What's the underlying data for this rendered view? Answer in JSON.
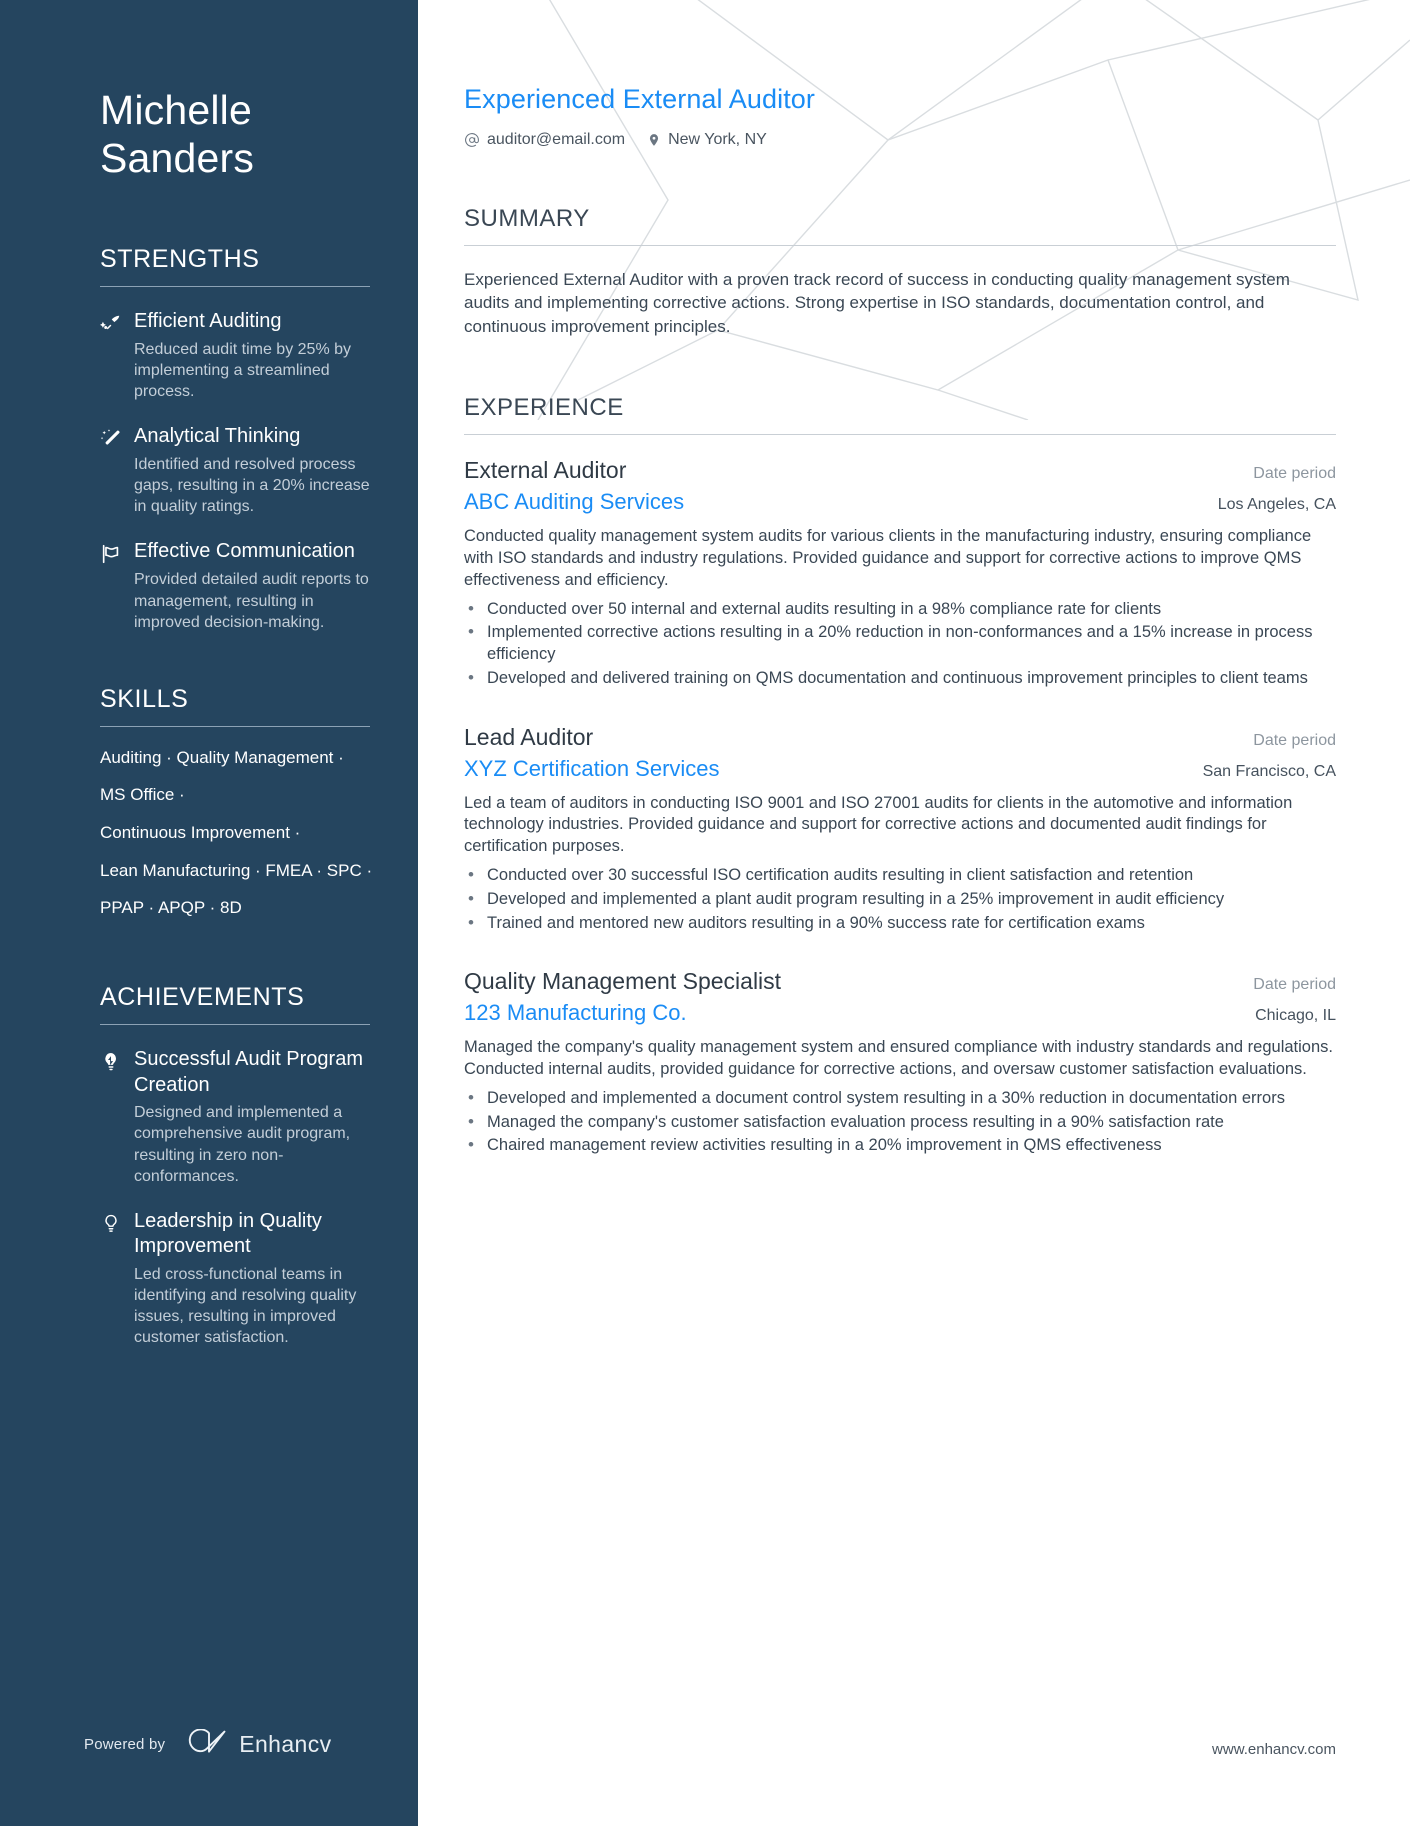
{
  "theme": {
    "sidebar_bg": "#25455f",
    "accent_blue": "#1a8cf5",
    "body_text": "#3a4754",
    "muted_text": "#8d969f"
  },
  "sidebar": {
    "name_first": "Michelle",
    "name_last": "Sanders",
    "strengths_heading": "STRENGTHS",
    "strengths": [
      {
        "icon": "rocket-trend-icon",
        "title": "Efficient Auditing",
        "desc": "Reduced audit time by 25% by implementing a streamlined process."
      },
      {
        "icon": "magic-wand-icon",
        "title": "Analytical Thinking",
        "desc": "Identified and resolved process gaps, resulting in a 20% increase in quality ratings."
      },
      {
        "icon": "flag-icon",
        "title": "Effective Communication",
        "desc": "Provided detailed audit reports to management, resulting in improved decision-making."
      }
    ],
    "skills_heading": "SKILLS",
    "skills_lines": [
      "Auditing · Quality Management ·",
      "MS Office ·",
      "Continuous Improvement ·",
      "Lean Manufacturing · FMEA · SPC ·",
      "PPAP · APQP · 8D"
    ],
    "achievements_heading": "ACHIEVEMENTS",
    "achievements": [
      {
        "icon": "lightbulb-filled-icon",
        "title": "Successful Audit Program Creation",
        "desc": "Designed and implemented a comprehensive audit program, resulting in zero non-conformances."
      },
      {
        "icon": "lightbulb-outline-icon",
        "title": "Leadership in Quality Improvement",
        "desc": "Led cross-functional teams in identifying and resolving quality issues, resulting in improved customer satisfaction."
      }
    ],
    "footer": {
      "powered_by": "Powered by",
      "brand": "Enhancv",
      "logo_icon": "enhancv-infinity-icon"
    }
  },
  "main": {
    "headline": "Experienced External Auditor",
    "contact": [
      {
        "icon": "at-sign-icon",
        "value": "auditor@email.com"
      },
      {
        "icon": "map-pin-icon",
        "value": "New York, NY"
      }
    ],
    "summary": {
      "heading": "SUMMARY",
      "text": "Experienced External Auditor with a proven track record of success in conducting quality management system audits and implementing corrective actions. Strong expertise in ISO standards, documentation control, and continuous improvement principles."
    },
    "experience": {
      "heading": "EXPERIENCE",
      "jobs": [
        {
          "position": "External Auditor",
          "date": "Date period",
          "company": "ABC Auditing Services",
          "location": "Los Angeles, CA",
          "description": "Conducted quality management system audits for various clients in the manufacturing industry, ensuring compliance with ISO standards and industry regulations. Provided guidance and support for corrective actions to improve QMS effectiveness and efficiency.",
          "bullets": [
            "Conducted over 50 internal and external audits resulting in a 98% compliance rate for clients",
            "Implemented corrective actions resulting in a 20% reduction in non-conformances and a 15% increase in process efficiency",
            "Developed and delivered training on QMS documentation and continuous improvement principles to client teams"
          ]
        },
        {
          "position": "Lead Auditor",
          "date": "Date period",
          "company": "XYZ Certification Services",
          "location": "San Francisco, CA",
          "description": "Led a team of auditors in conducting ISO 9001 and ISO 27001 audits for clients in the automotive and information technology industries. Provided guidance and support for corrective actions and documented audit findings for certification purposes.",
          "bullets": [
            "Conducted over 30 successful ISO certification audits resulting in client satisfaction and retention",
            "Developed and implemented a plant audit program resulting in a 25% improvement in audit efficiency",
            "Trained and mentored new auditors resulting in a 90% success rate for certification exams"
          ]
        },
        {
          "position": "Quality Management Specialist",
          "date": "Date period",
          "company": "123 Manufacturing Co.",
          "location": "Chicago, IL",
          "description": "Managed the company's quality management system and ensured compliance with industry standards and regulations. Conducted internal audits, provided guidance for corrective actions, and oversaw customer satisfaction evaluations.",
          "bullets": [
            "Developed and implemented a document control system resulting in a 30% reduction in documentation errors",
            "Managed the company's customer satisfaction evaluation process resulting in a 90% satisfaction rate",
            "Chaired management review activities resulting in a 20% improvement in QMS effectiveness"
          ]
        }
      ]
    },
    "site_url": "www.enhancv.com"
  }
}
